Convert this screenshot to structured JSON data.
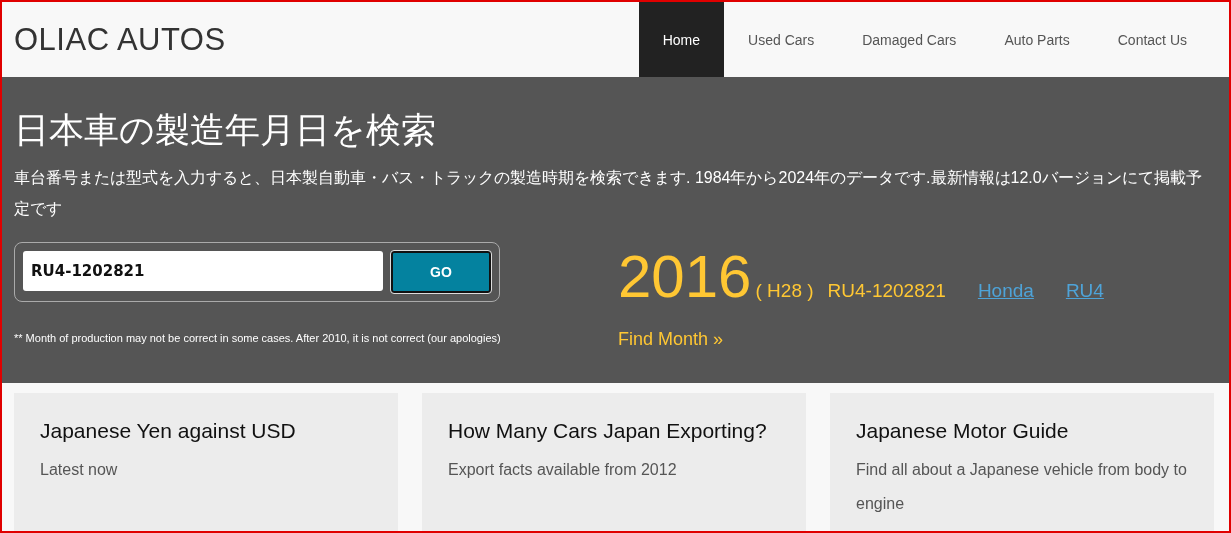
{
  "logo": "OLIAC AUTOS",
  "nav": [
    {
      "label": "Home",
      "selected": true
    },
    {
      "label": "Used Cars",
      "selected": false
    },
    {
      "label": "Damaged Cars",
      "selected": false
    },
    {
      "label": "Auto Parts",
      "selected": false
    },
    {
      "label": "Contact Us",
      "selected": false
    }
  ],
  "hero": {
    "title": "日本車の製造年月日を検索",
    "description": "車台番号または型式を入力すると、日本製自動車・バス・トラックの製造時期を検索できます. 1984年から2024年のデータです.最新情報は12.0バージョンにて掲載予定です",
    "search": {
      "value": "RU4-1202821",
      "button": "GO"
    },
    "note": "** Month of production may not be correct in some cases. After 2010, it is not correct (our apologies)",
    "result": {
      "year": "2016",
      "era": "( H28 )",
      "chassis": "RU4-1202821",
      "links": [
        "Honda",
        "RU4"
      ],
      "find_month": "Find Month »"
    }
  },
  "cards": [
    {
      "title": "Japanese Yen against USD",
      "subtitle": "Latest now"
    },
    {
      "title": "How Many Cars Japan Exporting?",
      "subtitle": "Export facts available from 2012"
    },
    {
      "title": "Japanese Motor Guide",
      "subtitle": "Find all about a Japanese vehicle from body to engine"
    }
  ]
}
